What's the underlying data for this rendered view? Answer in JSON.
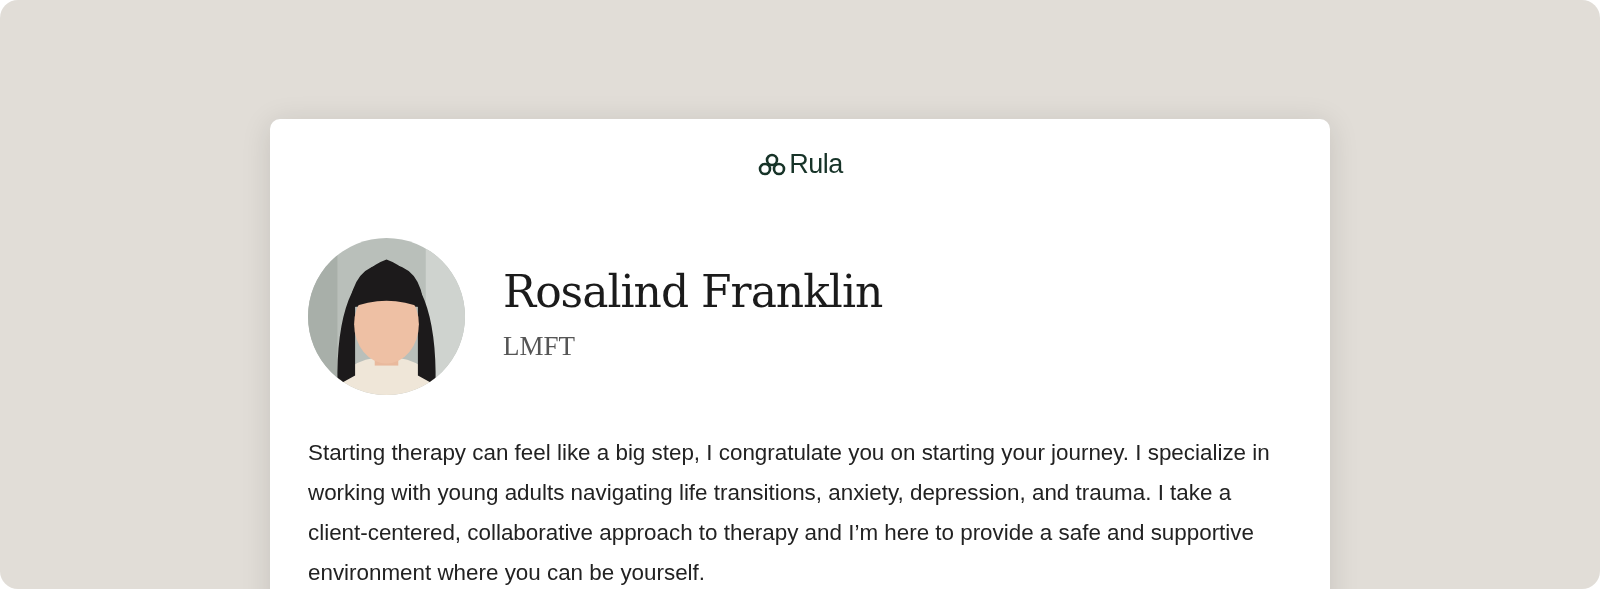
{
  "logo": {
    "text": "Rula"
  },
  "profile": {
    "name": "Rosalind Franklin",
    "credential": "LMFT"
  },
  "bio": "Starting therapy can feel like a big step, I congratulate you on starting your journey. I specialize in working with young adults navigating life transitions, anxiety, depression, and trauma. I take a client-centered, collaborative approach to therapy and I’m here to provide a safe and supportive environment where you can be yourself."
}
